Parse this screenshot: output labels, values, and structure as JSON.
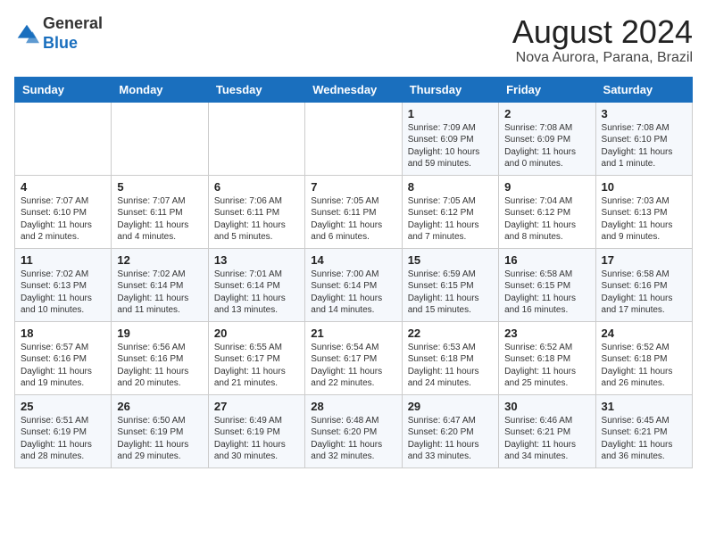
{
  "header": {
    "logo_line1": "General",
    "logo_line2": "Blue",
    "month_year": "August 2024",
    "location": "Nova Aurora, Parana, Brazil"
  },
  "days_of_week": [
    "Sunday",
    "Monday",
    "Tuesday",
    "Wednesday",
    "Thursday",
    "Friday",
    "Saturday"
  ],
  "weeks": [
    [
      {
        "day": "",
        "detail": ""
      },
      {
        "day": "",
        "detail": ""
      },
      {
        "day": "",
        "detail": ""
      },
      {
        "day": "",
        "detail": ""
      },
      {
        "day": "1",
        "detail": "Sunrise: 7:09 AM\nSunset: 6:09 PM\nDaylight: 10 hours\nand 59 minutes."
      },
      {
        "day": "2",
        "detail": "Sunrise: 7:08 AM\nSunset: 6:09 PM\nDaylight: 11 hours\nand 0 minutes."
      },
      {
        "day": "3",
        "detail": "Sunrise: 7:08 AM\nSunset: 6:10 PM\nDaylight: 11 hours\nand 1 minute."
      }
    ],
    [
      {
        "day": "4",
        "detail": "Sunrise: 7:07 AM\nSunset: 6:10 PM\nDaylight: 11 hours\nand 2 minutes."
      },
      {
        "day": "5",
        "detail": "Sunrise: 7:07 AM\nSunset: 6:11 PM\nDaylight: 11 hours\nand 4 minutes."
      },
      {
        "day": "6",
        "detail": "Sunrise: 7:06 AM\nSunset: 6:11 PM\nDaylight: 11 hours\nand 5 minutes."
      },
      {
        "day": "7",
        "detail": "Sunrise: 7:05 AM\nSunset: 6:11 PM\nDaylight: 11 hours\nand 6 minutes."
      },
      {
        "day": "8",
        "detail": "Sunrise: 7:05 AM\nSunset: 6:12 PM\nDaylight: 11 hours\nand 7 minutes."
      },
      {
        "day": "9",
        "detail": "Sunrise: 7:04 AM\nSunset: 6:12 PM\nDaylight: 11 hours\nand 8 minutes."
      },
      {
        "day": "10",
        "detail": "Sunrise: 7:03 AM\nSunset: 6:13 PM\nDaylight: 11 hours\nand 9 minutes."
      }
    ],
    [
      {
        "day": "11",
        "detail": "Sunrise: 7:02 AM\nSunset: 6:13 PM\nDaylight: 11 hours\nand 10 minutes."
      },
      {
        "day": "12",
        "detail": "Sunrise: 7:02 AM\nSunset: 6:14 PM\nDaylight: 11 hours\nand 11 minutes."
      },
      {
        "day": "13",
        "detail": "Sunrise: 7:01 AM\nSunset: 6:14 PM\nDaylight: 11 hours\nand 13 minutes."
      },
      {
        "day": "14",
        "detail": "Sunrise: 7:00 AM\nSunset: 6:14 PM\nDaylight: 11 hours\nand 14 minutes."
      },
      {
        "day": "15",
        "detail": "Sunrise: 6:59 AM\nSunset: 6:15 PM\nDaylight: 11 hours\nand 15 minutes."
      },
      {
        "day": "16",
        "detail": "Sunrise: 6:58 AM\nSunset: 6:15 PM\nDaylight: 11 hours\nand 16 minutes."
      },
      {
        "day": "17",
        "detail": "Sunrise: 6:58 AM\nSunset: 6:16 PM\nDaylight: 11 hours\nand 17 minutes."
      }
    ],
    [
      {
        "day": "18",
        "detail": "Sunrise: 6:57 AM\nSunset: 6:16 PM\nDaylight: 11 hours\nand 19 minutes."
      },
      {
        "day": "19",
        "detail": "Sunrise: 6:56 AM\nSunset: 6:16 PM\nDaylight: 11 hours\nand 20 minutes."
      },
      {
        "day": "20",
        "detail": "Sunrise: 6:55 AM\nSunset: 6:17 PM\nDaylight: 11 hours\nand 21 minutes."
      },
      {
        "day": "21",
        "detail": "Sunrise: 6:54 AM\nSunset: 6:17 PM\nDaylight: 11 hours\nand 22 minutes."
      },
      {
        "day": "22",
        "detail": "Sunrise: 6:53 AM\nSunset: 6:18 PM\nDaylight: 11 hours\nand 24 minutes."
      },
      {
        "day": "23",
        "detail": "Sunrise: 6:52 AM\nSunset: 6:18 PM\nDaylight: 11 hours\nand 25 minutes."
      },
      {
        "day": "24",
        "detail": "Sunrise: 6:52 AM\nSunset: 6:18 PM\nDaylight: 11 hours\nand 26 minutes."
      }
    ],
    [
      {
        "day": "25",
        "detail": "Sunrise: 6:51 AM\nSunset: 6:19 PM\nDaylight: 11 hours\nand 28 minutes."
      },
      {
        "day": "26",
        "detail": "Sunrise: 6:50 AM\nSunset: 6:19 PM\nDaylight: 11 hours\nand 29 minutes."
      },
      {
        "day": "27",
        "detail": "Sunrise: 6:49 AM\nSunset: 6:19 PM\nDaylight: 11 hours\nand 30 minutes."
      },
      {
        "day": "28",
        "detail": "Sunrise: 6:48 AM\nSunset: 6:20 PM\nDaylight: 11 hours\nand 32 minutes."
      },
      {
        "day": "29",
        "detail": "Sunrise: 6:47 AM\nSunset: 6:20 PM\nDaylight: 11 hours\nand 33 minutes."
      },
      {
        "day": "30",
        "detail": "Sunrise: 6:46 AM\nSunset: 6:21 PM\nDaylight: 11 hours\nand 34 minutes."
      },
      {
        "day": "31",
        "detail": "Sunrise: 6:45 AM\nSunset: 6:21 PM\nDaylight: 11 hours\nand 36 minutes."
      }
    ]
  ]
}
